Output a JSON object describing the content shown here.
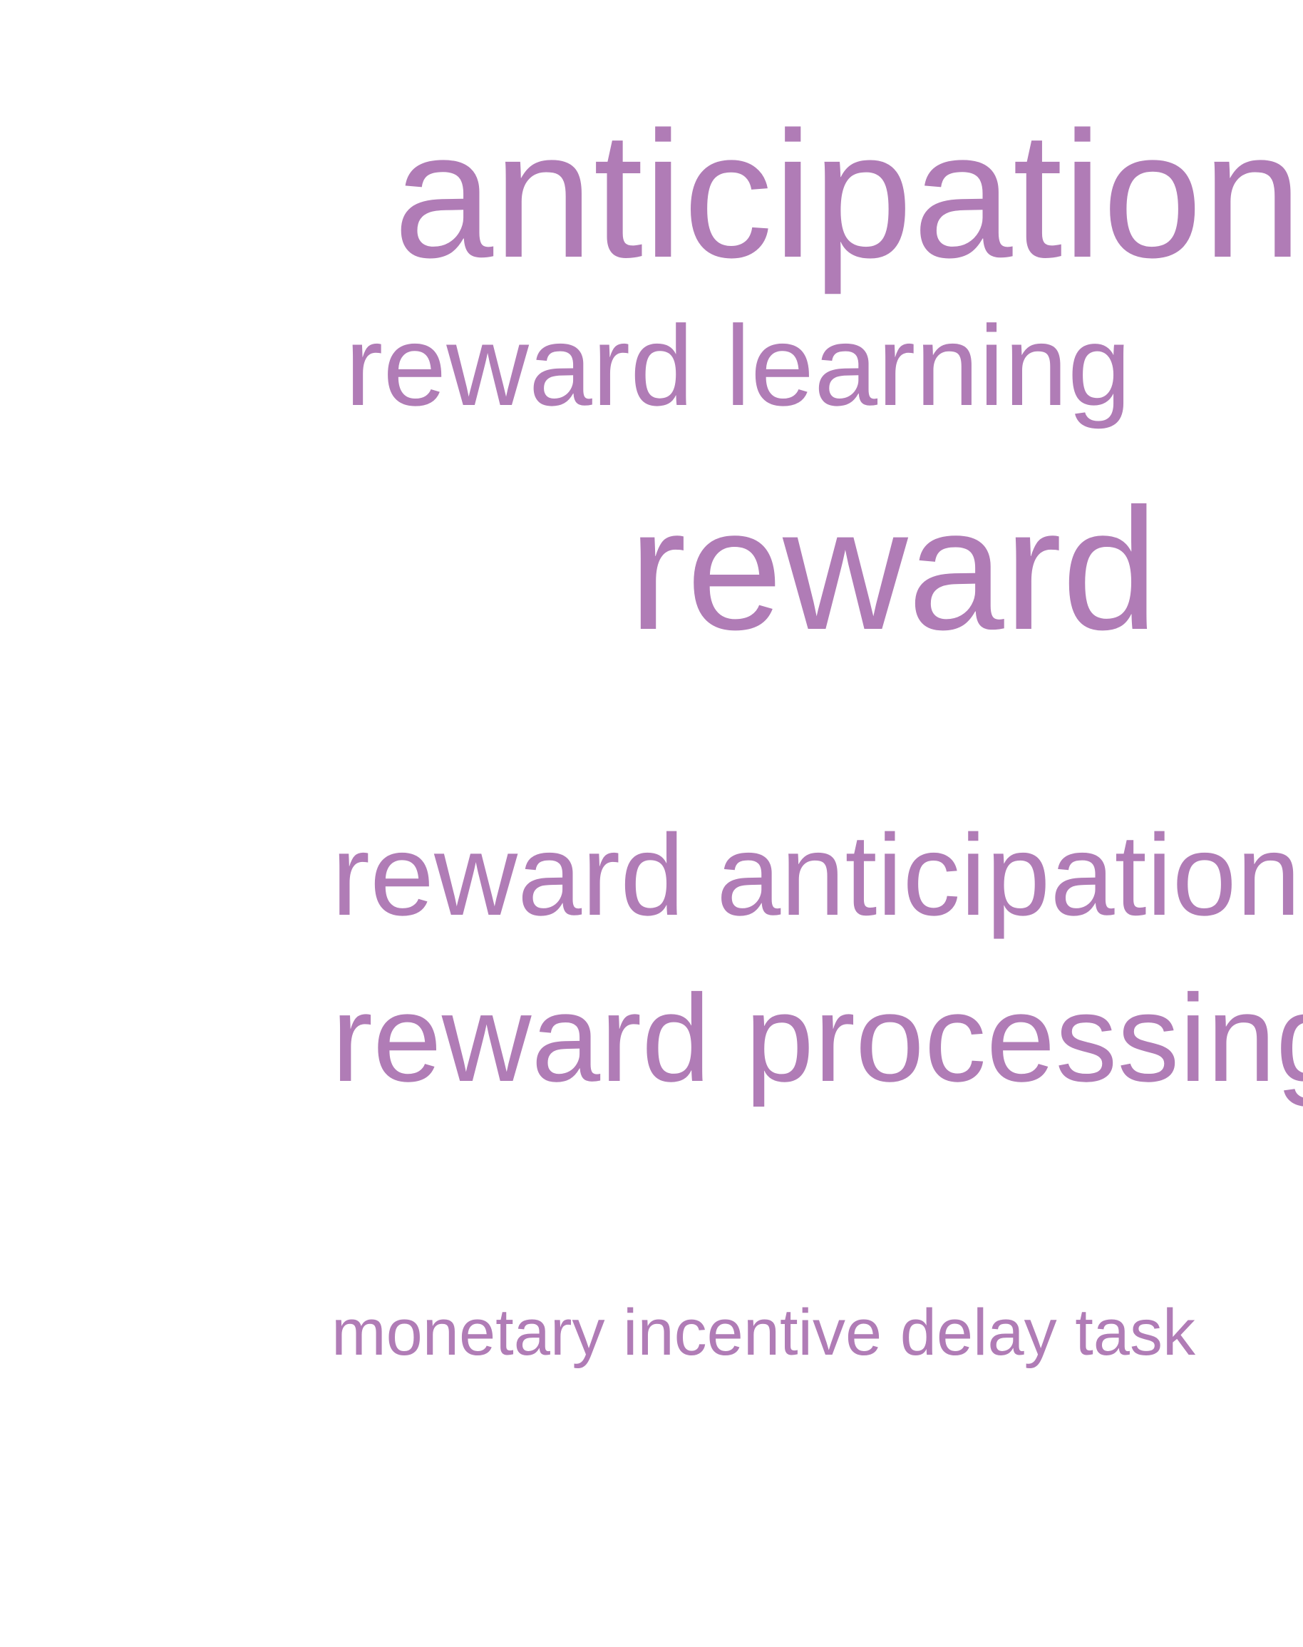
{
  "word_cloud": {
    "color": "#b07cb6",
    "terms": [
      {
        "id": "anticipation",
        "text": "anticipation"
      },
      {
        "id": "reward-learning",
        "text": "reward learning"
      },
      {
        "id": "reward",
        "text": "reward"
      },
      {
        "id": "reward-anticipation",
        "text": "reward anticipation"
      },
      {
        "id": "reward-processing",
        "text": "reward processing"
      },
      {
        "id": "monetary-incentive-delay-task",
        "text": "monetary incentive delay task"
      }
    ]
  }
}
